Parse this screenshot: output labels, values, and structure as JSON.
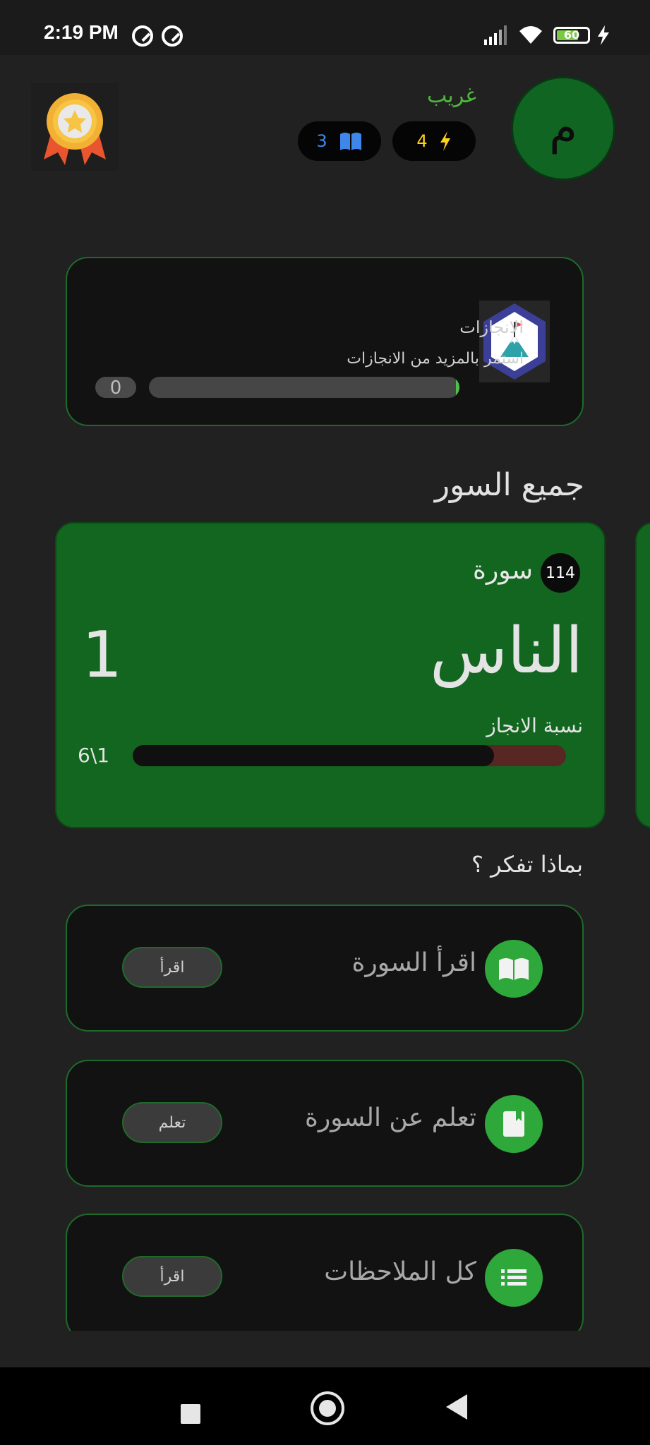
{
  "status_bar": {
    "time": "2:19 PM",
    "battery_level": "60"
  },
  "header": {
    "avatar_letter": "م",
    "username": "غريب",
    "energy_count": "4",
    "reading_count": "3"
  },
  "achievements": {
    "title": "الانجازات",
    "subtitle": "استمر بالمزيد من الانجازات",
    "count": "0",
    "progress": 0.01
  },
  "surahs": {
    "section_title": "جميع السور",
    "card": {
      "count_badge": "114",
      "count_word": "سورة",
      "name": "الناس",
      "number": "1",
      "progress_label": "نسبة الانجاز",
      "fraction": "6\\1",
      "progress": 0.1667
    }
  },
  "think": {
    "title": "بماذا تفكر ؟",
    "actions": [
      {
        "label": "اقرأ السورة",
        "button": "اقرأ",
        "icon": "open-book-icon"
      },
      {
        "label": "تعلم عن السورة",
        "button": "تعلم",
        "icon": "book-icon"
      },
      {
        "label": "كل الملاحظات",
        "button": "اقرأ",
        "icon": "list-icon"
      }
    ]
  },
  "colors": {
    "background": "#212121",
    "primary_green": "#12661f",
    "accent_green": "#2ea83a",
    "energy_yellow": "#ffd21c",
    "reading_blue": "#3f86ea"
  }
}
